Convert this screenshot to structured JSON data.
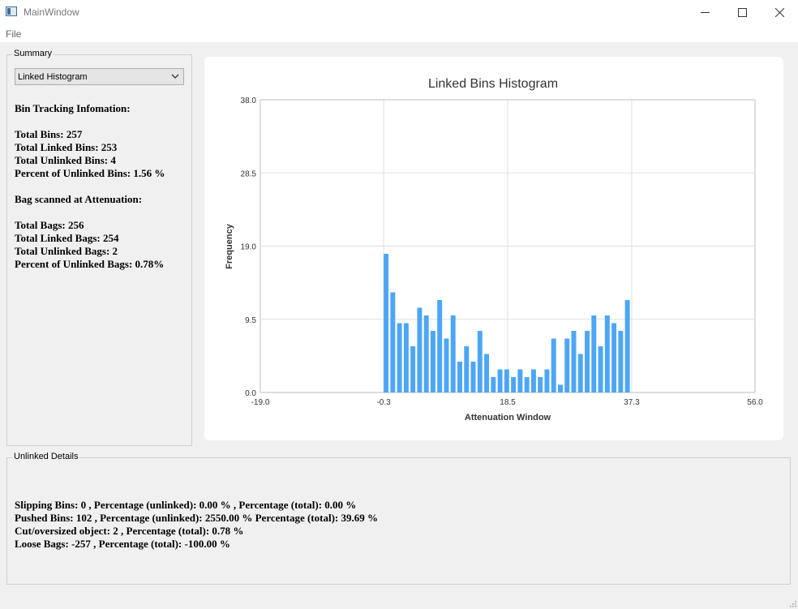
{
  "window": {
    "title": "MainWindow"
  },
  "menu": {
    "file": "File"
  },
  "summary": {
    "group_title": "Summary",
    "combo_value": "Linked Histogram",
    "bin_heading": "Bin Tracking Infomation:",
    "total_bins": "Total Bins: 257",
    "total_linked_bins": "Total Linked Bins: 253",
    "total_unlinked_bins": "Total Unlinked Bins: 4",
    "percent_unlinked_bins": "Percent of Unlinked Bins: 1.56 %",
    "bag_heading": "Bag scanned at Attenuation:",
    "total_bags": "Total Bags: 256",
    "total_linked_bags": "Total Linked Bags: 254",
    "total_unlinked_bags": "Total Unlinked Bags: 2",
    "percent_unlinked_bags": "Percent of Unlinked Bags: 0.78%"
  },
  "details": {
    "group_title": "Unlinked Details",
    "slipping": "Slipping Bins: 0 , Percentage (unlinked): 0.00 % , Percentage (total): 0.00 %",
    "pushed": "Pushed Bins: 102 , Percentage (unlinked): 2550.00 % Percentage (total): 39.69 %",
    "cut": "Cut/oversized object: 2 , Percentage (total): 0.78 %",
    "loose": "Loose Bags: -257 , Percentage (total): -100.00 %"
  },
  "colors": {
    "bar": "#4da6f5",
    "grid": "#e0e0e0",
    "axis": "#bdbdbd"
  },
  "chart_data": {
    "type": "bar",
    "title": "Linked Bins Histogram",
    "xlabel": "Attenuation Window",
    "ylabel": "Frequency",
    "xlim": [
      -19.0,
      56.0
    ],
    "ylim": [
      0.0,
      38.0
    ],
    "x_ticks": [
      "-19.0",
      "-0.3",
      "18.5",
      "37.3",
      "56.0"
    ],
    "y_ticks": [
      "0.0",
      "9.5",
      "19.0",
      "28.5",
      "38.0"
    ],
    "bar_x_start": -0.3,
    "bar_x_end": 37.3,
    "values": [
      18,
      13,
      9,
      9,
      6,
      11,
      10,
      8,
      12,
      7,
      10,
      4,
      6,
      4,
      8,
      5,
      2,
      3,
      3,
      2,
      3,
      2,
      3,
      2,
      3,
      7,
      1,
      7,
      8,
      5,
      8,
      10,
      6,
      10,
      9,
      8,
      12
    ]
  }
}
